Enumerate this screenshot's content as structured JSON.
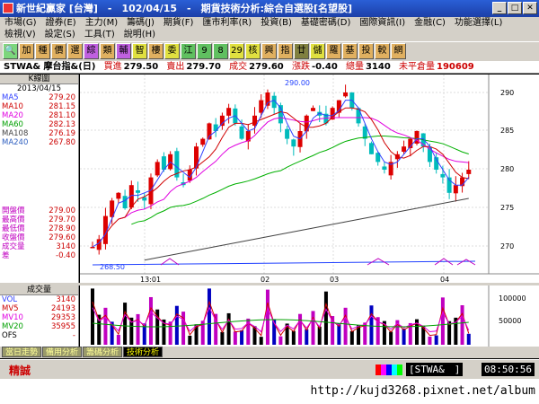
{
  "window": {
    "title": "新世紀贏家 [台灣]　-　102/04/15　-　期貨技術分析:綜合自選股[名望股]"
  },
  "menu1": [
    "市場(G)",
    "證券(E)",
    "主力(M)",
    "籌碼(J)",
    "期貨(F)",
    "匯市利率(R)",
    "投資(B)",
    "基礎密碼(D)",
    "國際資訊(I)",
    "金融(C)",
    "功能選擇(L)"
  ],
  "menu2": [
    "檢視(V)",
    "設定(S)",
    "工具(T)",
    "說明(H)"
  ],
  "toolbar": [
    "加",
    "種",
    "價",
    "選",
    "綜",
    "類",
    "輔",
    "智",
    "樓",
    "委",
    "江",
    "9",
    "8",
    "29",
    "核",
    "興",
    "指",
    "廿",
    "儲",
    "羅",
    "基",
    "投",
    "較",
    "網"
  ],
  "quote": {
    "symbol": "STWA& 摩台指&(日)",
    "bid_label": "買進",
    "bid": "279.50",
    "ask_label": "賣出",
    "ask": "279.70",
    "last_label": "成交",
    "last": "279.60",
    "change_label": "漲跌",
    "change": "-0.40",
    "vol_label": "總量",
    "vol": "3140",
    "oi_label": "未平倉量",
    "oi": "190609"
  },
  "left_panel": {
    "header": "K線圖",
    "date": "2013/04/15",
    "ma": [
      {
        "label": "MA5",
        "value": "279.20"
      },
      {
        "label": "MA10",
        "value": "281.15"
      },
      {
        "label": "MA20",
        "value": "281.10"
      },
      {
        "label": "MA60",
        "value": "282.13"
      },
      {
        "label": "MA108",
        "value": "276.19"
      },
      {
        "label": "MA240",
        "value": "267.80"
      }
    ],
    "prices": [
      {
        "label": "開盤價",
        "value": "279.00"
      },
      {
        "label": "最高價",
        "value": "279.70"
      },
      {
        "label": "最低價",
        "value": "278.90"
      },
      {
        "label": "收盤價",
        "value": "279.60"
      },
      {
        "label": "成交量",
        "value": "3140"
      },
      {
        "label": "差",
        "value": "-0.40"
      }
    ]
  },
  "vol_panel": {
    "header": "成交量",
    "items": [
      {
        "label": "VOL",
        "value": "3140"
      },
      {
        "label": "MV5",
        "value": "24193"
      },
      {
        "label": "MV10",
        "value": "29353"
      },
      {
        "label": "MV20",
        "value": "35955"
      },
      {
        "label": "OFS",
        "value": "-"
      }
    ]
  },
  "chart": {
    "high_label": "290.00",
    "low_label": "268.50",
    "y_ticks": [
      "290",
      "285",
      "280",
      "275",
      "270"
    ],
    "x_ticks": [
      "13:01",
      "02",
      "03",
      "04"
    ],
    "vol_ticks": [
      "100000",
      "50000"
    ]
  },
  "tabs": [
    "當日走勢",
    "備用分析",
    "籌碼分析",
    "技術分析"
  ],
  "status": {
    "label": "精誠",
    "ticker": "[STWA&　]",
    "clock": "08:50:56"
  },
  "watermark": "http://kujd3268.pixnet.net/album",
  "colors": {
    "up": "#dd0000",
    "down": "#00bbbb",
    "ma5": "#3040ff",
    "ma10": "#d00000",
    "ma20": "#e000e0",
    "ma60": "#00b000",
    "ma108": "#555555"
  }
}
